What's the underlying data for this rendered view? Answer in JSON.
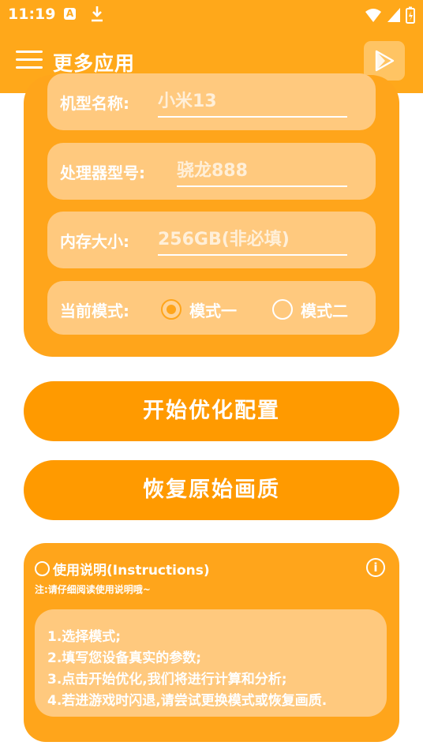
{
  "status_bar": {
    "time": "11:19",
    "icons": [
      "a-badge-icon",
      "download-icon",
      "wifi-icon",
      "signal-icon",
      "battery-icon"
    ]
  },
  "app_bar": {
    "title": "更多应用",
    "icons": [
      "hamburger-menu-icon",
      "play-icon"
    ]
  },
  "config": {
    "device_name": {
      "label": "机型名称:",
      "placeholder": "小米13"
    },
    "processor": {
      "label": "处理器型号:",
      "placeholder": "骁龙888"
    },
    "memory": {
      "label": "内存大小:",
      "placeholder": "256GB(非必填)"
    },
    "mode": {
      "label": "当前模式:",
      "options": [
        "模式一",
        "模式二"
      ],
      "selected": "模式一"
    }
  },
  "buttons": {
    "start": "开始优化配置",
    "restore": "恢复原始画质"
  },
  "instructions": {
    "title": "使用说明(Instructions)",
    "note": "注:请仔细阅读使用说明哦~",
    "steps": [
      "1.选择模式;",
      "2.填写您设备真实的参数;",
      "3.点击开始优化,我们将进行计算和分析;",
      "4.若进游戏时闪退,请尝试更换模式或恢复画质."
    ]
  },
  "colors": {
    "primary": "#FFA81A",
    "card": "#FFA51B",
    "field": "#FFC97E",
    "button": "#FF9A00",
    "text": "#FFFFFF"
  }
}
